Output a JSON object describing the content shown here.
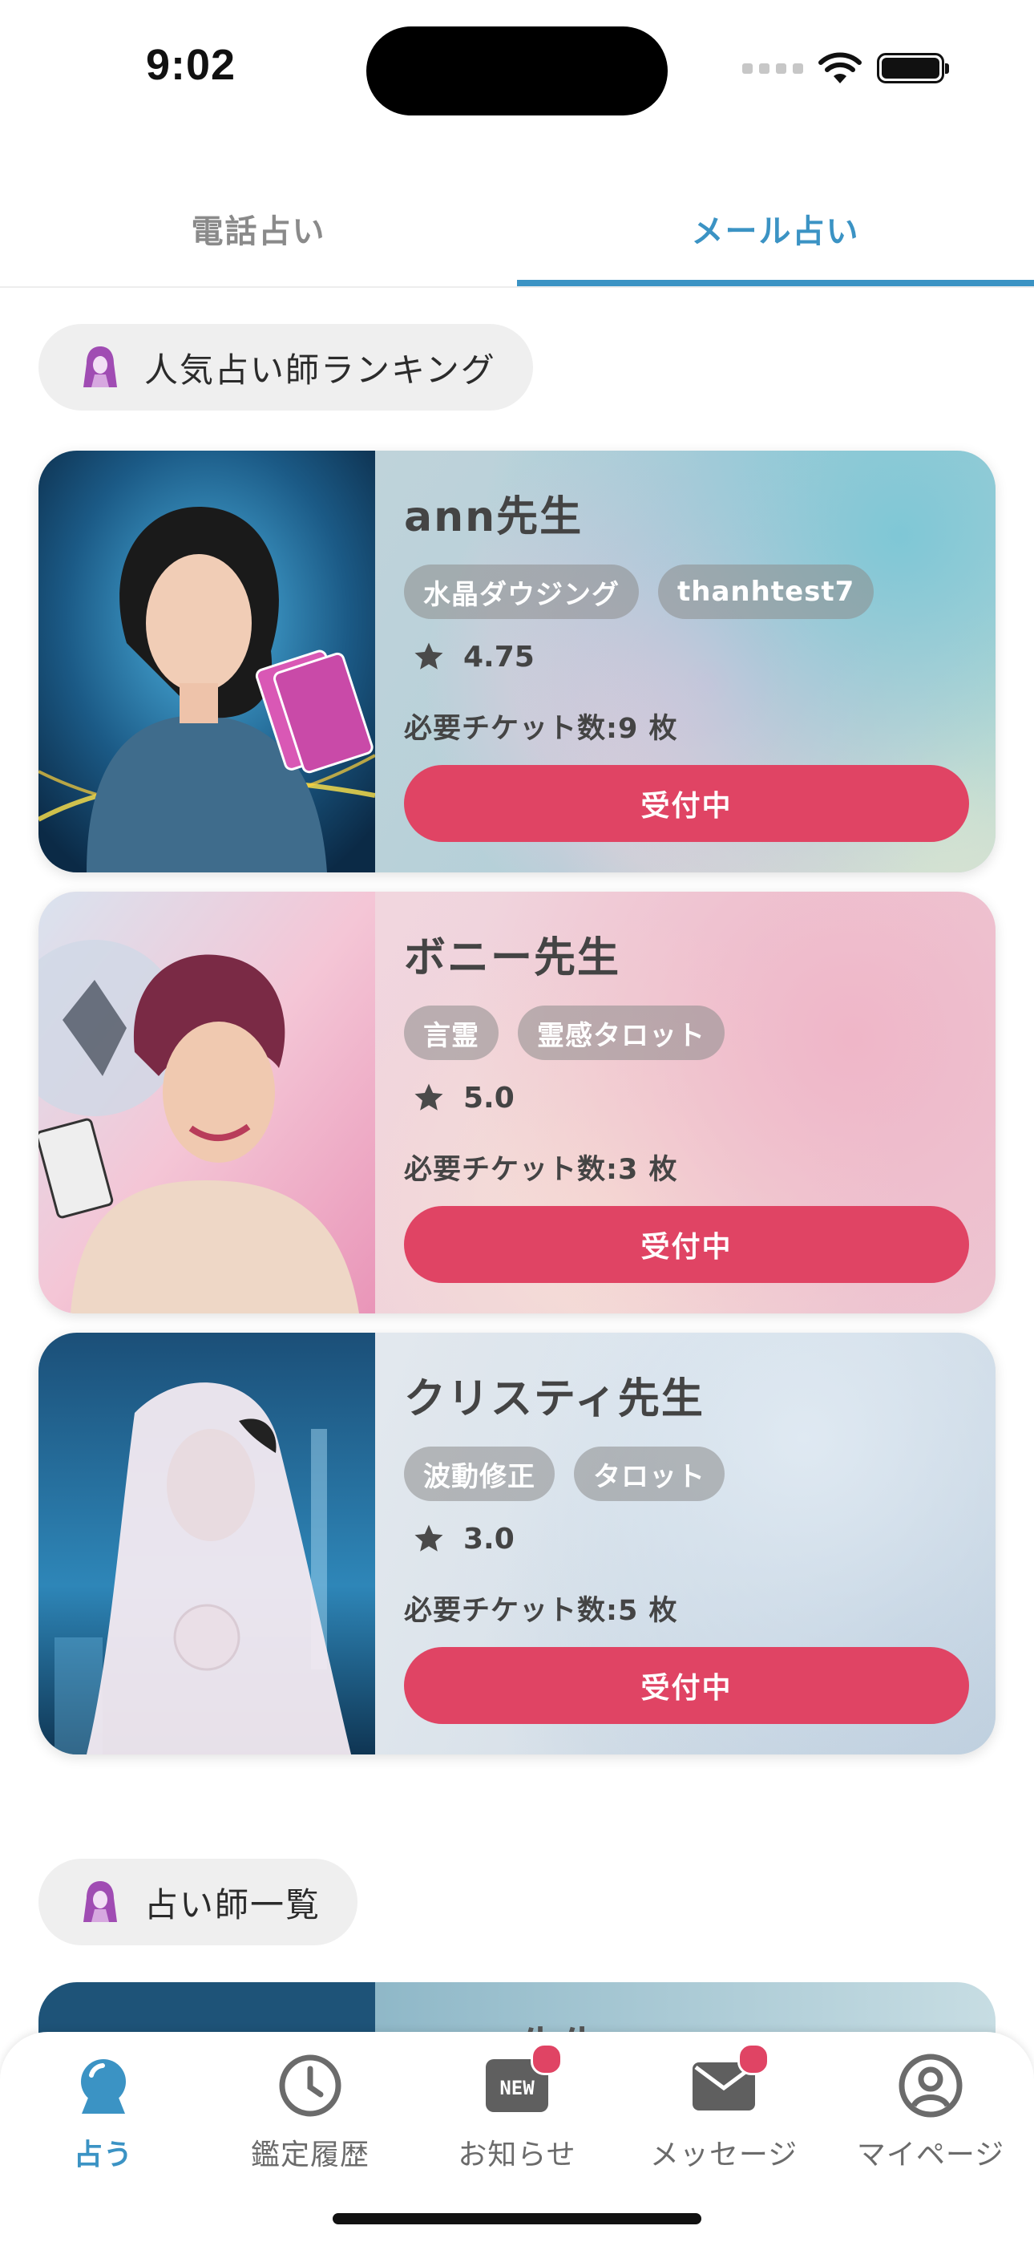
{
  "status_bar": {
    "time": "9:02"
  },
  "tabs": [
    {
      "label": "電話占い",
      "active": false
    },
    {
      "label": "メール占い",
      "active": true
    }
  ],
  "ranking_section": {
    "title": "人気占い師ランキング",
    "icon": "fortune-teller-icon"
  },
  "list_section": {
    "title": "占い師一覧",
    "icon": "fortune-teller-icon"
  },
  "fortune_tellers": [
    {
      "name": "ann先生",
      "tags": [
        "水晶ダウジング",
        "thanhtest7"
      ],
      "rating": "4.75",
      "tickets": "必要チケット数:9 枚",
      "button": "受付中"
    },
    {
      "name": "ボニー先生",
      "tags": [
        "言霊",
        "霊感タロット"
      ],
      "rating": "5.0",
      "tickets": "必要チケット数:3 枚",
      "button": "受付中"
    },
    {
      "name": "クリスティ先生",
      "tags": [
        "波動修正",
        "タロット"
      ],
      "rating": "3.0",
      "tickets": "必要チケット数:5 枚",
      "button": "受付中"
    }
  ],
  "partial_card": {
    "name": "先生"
  },
  "bottom_nav": [
    {
      "label": "占う",
      "icon": "crystal-ball-icon",
      "active": true
    },
    {
      "label": "鑑定履歴",
      "icon": "clock-icon",
      "active": false
    },
    {
      "label": "お知らせ",
      "icon": "new-badge-icon",
      "active": false,
      "badge": true
    },
    {
      "label": "メッセージ",
      "icon": "mail-icon",
      "active": false,
      "badge": true
    },
    {
      "label": "マイページ",
      "icon": "user-circle-icon",
      "active": false
    }
  ],
  "colors": {
    "accent": "#3b93c4",
    "button": "#e04464",
    "pill": "#efefef"
  }
}
